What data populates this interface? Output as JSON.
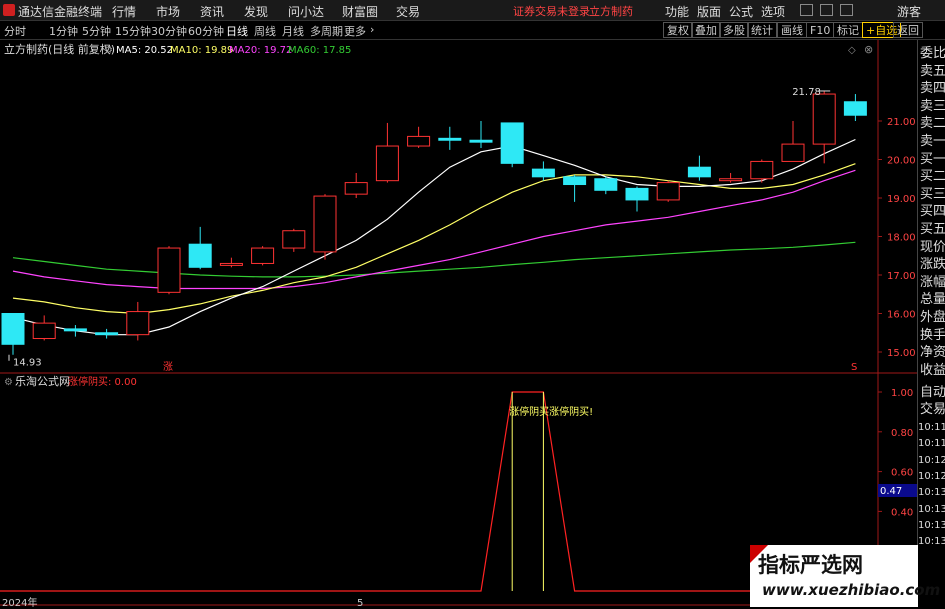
{
  "app": {
    "title": "通达信金融终端"
  },
  "menu": [
    "行情",
    "市场",
    "资讯",
    "发现",
    "问小达",
    "财富圈",
    "交易"
  ],
  "warning": "证券交易未登录",
  "stock_name_top": "立方制药",
  "right_menu": [
    "功能",
    "版面",
    "公式",
    "选项"
  ],
  "guest": "游客",
  "periods": [
    "分时",
    "1分钟",
    "5分钟",
    "15分钟",
    "30分钟",
    "60分钟",
    "日线",
    "周线",
    "月线",
    "多周期",
    "更多"
  ],
  "active_period": "日线",
  "tool_buttons": [
    "复权",
    "叠加",
    "多股",
    "统计",
    "画线",
    "F10",
    "标记",
    "+自选",
    "返回"
  ],
  "main_chart": {
    "title": "立方制药(日线 前复权)",
    "ma_labels": [
      {
        "label": "MA5: 20.52",
        "color": "#ffffff"
      },
      {
        "label": "MA10: 19.89",
        "color": "#ffff66"
      },
      {
        "label": "MA20: 19.72",
        "color": "#ff44ff"
      },
      {
        "label": "MA60: 17.85",
        "color": "#33cc33"
      }
    ],
    "price_axis": [
      "21.00",
      "20.00",
      "19.00",
      "18.00",
      "17.00",
      "16.00",
      "15.00"
    ],
    "high_label": "21.78",
    "low_label": "14.93",
    "marker_zhang": "涨",
    "marker_s": "S"
  },
  "sub_chart": {
    "title": "乐淘公式网",
    "indicator": "涨停阴买: 0.00",
    "axis": [
      "1.00",
      "0.80",
      "0.60",
      "0.40",
      "0.20"
    ],
    "current_value": "0.47",
    "annotation": "涨停阴买涨停阴买!"
  },
  "x_axis": {
    "year": "2024年",
    "month": "5"
  },
  "right_panel": {
    "labels": [
      "委比",
      "卖五",
      "卖四",
      "卖三",
      "卖二",
      "卖一",
      "买一",
      "买二",
      "买三",
      "买四",
      "买五",
      "现价",
      "涨跌",
      "涨幅",
      "总量",
      "外盘",
      "换手",
      "净资",
      "收益"
    ],
    "bottom_labels": [
      "自动",
      "交易"
    ],
    "times": [
      "10:11",
      "10:11",
      "10:12",
      "10:12",
      "10:13",
      "10:13",
      "10:13",
      "10:13"
    ]
  },
  "watermark": {
    "line1": "指标严选网",
    "line2": "www.xuezhibiao.com"
  },
  "colors": {
    "up": "#ff3333",
    "down": "#2ee8f5",
    "ma5": "#ffffff",
    "ma10": "#ffff66",
    "ma20": "#ff44ff",
    "ma60": "#33cc33",
    "signal": "#ff2222",
    "signal_inner": "#ffff66"
  },
  "chart_data": {
    "type": "candlestick",
    "ylim": [
      14.93,
      21.78
    ],
    "candles": [
      {
        "o": 16.0,
        "c": 15.2,
        "h": 16.0,
        "l": 14.93
      },
      {
        "o": 15.35,
        "c": 15.75,
        "h": 15.95,
        "l": 15.3
      },
      {
        "o": 15.6,
        "c": 15.55,
        "h": 15.7,
        "l": 15.4
      },
      {
        "o": 15.5,
        "c": 15.45,
        "h": 15.6,
        "l": 15.35
      },
      {
        "o": 15.45,
        "c": 16.05,
        "h": 16.3,
        "l": 15.3
      },
      {
        "o": 16.55,
        "c": 17.7,
        "h": 17.75,
        "l": 16.5
      },
      {
        "o": 17.8,
        "c": 17.2,
        "h": 18.25,
        "l": 17.15
      },
      {
        "o": 17.25,
        "c": 17.3,
        "h": 17.45,
        "l": 17.2
      },
      {
        "o": 17.3,
        "c": 17.7,
        "h": 17.75,
        "l": 17.25
      },
      {
        "o": 17.7,
        "c": 18.15,
        "h": 18.2,
        "l": 17.6
      },
      {
        "o": 17.6,
        "c": 19.05,
        "h": 19.1,
        "l": 17.4
      },
      {
        "o": 19.1,
        "c": 19.4,
        "h": 19.65,
        "l": 19.0
      },
      {
        "o": 19.45,
        "c": 20.35,
        "h": 20.95,
        "l": 19.4
      },
      {
        "o": 20.35,
        "c": 20.6,
        "h": 20.85,
        "l": 20.3
      },
      {
        "o": 20.55,
        "c": 20.5,
        "h": 20.85,
        "l": 20.25
      },
      {
        "o": 20.5,
        "c": 20.45,
        "h": 21.0,
        "l": 20.3
      },
      {
        "o": 20.95,
        "c": 19.9,
        "h": 20.95,
        "l": 19.8
      },
      {
        "o": 19.75,
        "c": 19.55,
        "h": 19.95,
        "l": 19.45
      },
      {
        "o": 19.55,
        "c": 19.35,
        "h": 19.6,
        "l": 18.9
      },
      {
        "o": 19.5,
        "c": 19.2,
        "h": 19.55,
        "l": 19.1
      },
      {
        "o": 19.25,
        "c": 18.95,
        "h": 19.3,
        "l": 18.65
      },
      {
        "o": 18.95,
        "c": 19.4,
        "h": 19.45,
        "l": 18.9
      },
      {
        "o": 19.8,
        "c": 19.55,
        "h": 20.1,
        "l": 19.45
      },
      {
        "o": 19.45,
        "c": 19.5,
        "h": 19.65,
        "l": 19.4
      },
      {
        "o": 19.5,
        "c": 19.95,
        "h": 20.0,
        "l": 19.4
      },
      {
        "o": 19.95,
        "c": 20.4,
        "h": 21.0,
        "l": 19.95
      },
      {
        "o": 20.4,
        "c": 21.7,
        "h": 21.78,
        "l": 19.9
      },
      {
        "o": 21.5,
        "c": 21.15,
        "h": 21.7,
        "l": 21.0
      }
    ],
    "ma5": [
      15.9,
      15.7,
      15.55,
      15.45,
      15.45,
      15.65,
      16.05,
      16.4,
      16.7,
      17.1,
      17.5,
      17.9,
      18.45,
      19.15,
      19.8,
      20.2,
      20.35,
      20.1,
      19.85,
      19.55,
      19.35,
      19.3,
      19.3,
      19.35,
      19.45,
      19.75,
      20.15,
      20.52
    ],
    "ma10": [
      16.4,
      16.3,
      16.15,
      16.05,
      16.0,
      16.1,
      16.25,
      16.45,
      16.6,
      16.8,
      16.95,
      17.2,
      17.55,
      17.9,
      18.3,
      18.75,
      19.15,
      19.45,
      19.6,
      19.6,
      19.55,
      19.45,
      19.35,
      19.25,
      19.25,
      19.35,
      19.6,
      19.89
    ],
    "ma20": [
      17.1,
      16.95,
      16.85,
      16.75,
      16.7,
      16.65,
      16.65,
      16.65,
      16.65,
      16.7,
      16.8,
      16.95,
      17.1,
      17.25,
      17.4,
      17.6,
      17.8,
      18.0,
      18.15,
      18.3,
      18.4,
      18.5,
      18.65,
      18.8,
      18.95,
      19.15,
      19.45,
      19.72
    ],
    "ma60": [
      17.45,
      17.35,
      17.25,
      17.15,
      17.1,
      17.05,
      17.0,
      16.97,
      16.95,
      16.95,
      16.97,
      17.0,
      17.05,
      17.1,
      17.15,
      17.2,
      17.27,
      17.33,
      17.4,
      17.45,
      17.5,
      17.55,
      17.6,
      17.65,
      17.68,
      17.72,
      17.78,
      17.85
    ],
    "signal": [
      0,
      0,
      0,
      0,
      0,
      0,
      0,
      0,
      0,
      0,
      0,
      0,
      0,
      0,
      0,
      0,
      1,
      1,
      0,
      0,
      0,
      0,
      0,
      0,
      0,
      0,
      0,
      0
    ]
  }
}
